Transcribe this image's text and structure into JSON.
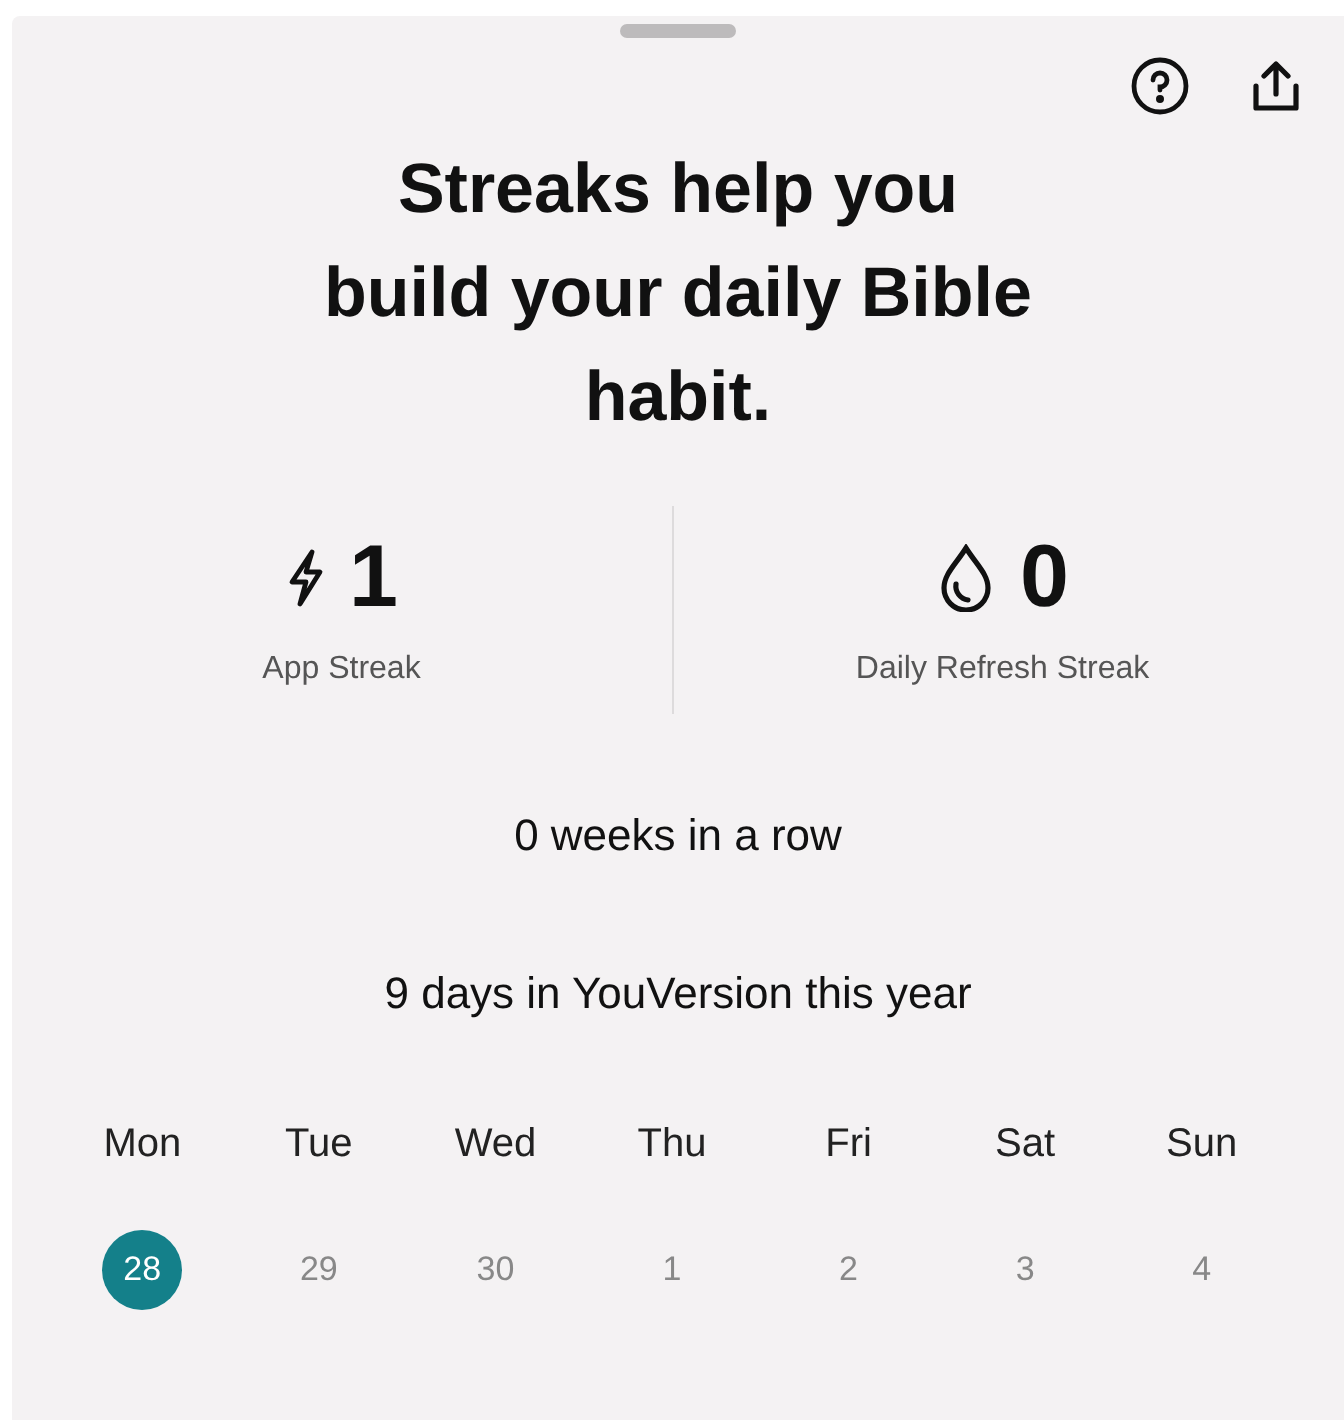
{
  "title": "Streaks help you build your daily Bible habit.",
  "streaks": [
    {
      "kind": "bolt",
      "value": "1",
      "label": "App Streak"
    },
    {
      "kind": "drop",
      "value": "0",
      "label": "Daily Refresh Streak"
    }
  ],
  "weeks_in_row": "0 weeks in a row",
  "days_this_year": "9 days in YouVersion this year",
  "week": [
    {
      "day": "Mon",
      "date": "28",
      "selected": true
    },
    {
      "day": "Tue",
      "date": "29",
      "selected": false
    },
    {
      "day": "Wed",
      "date": "30",
      "selected": false
    },
    {
      "day": "Thu",
      "date": "1",
      "selected": false
    },
    {
      "day": "Fri",
      "date": "2",
      "selected": false
    },
    {
      "day": "Sat",
      "date": "3",
      "selected": false
    },
    {
      "day": "Sun",
      "date": "4",
      "selected": false
    }
  ]
}
